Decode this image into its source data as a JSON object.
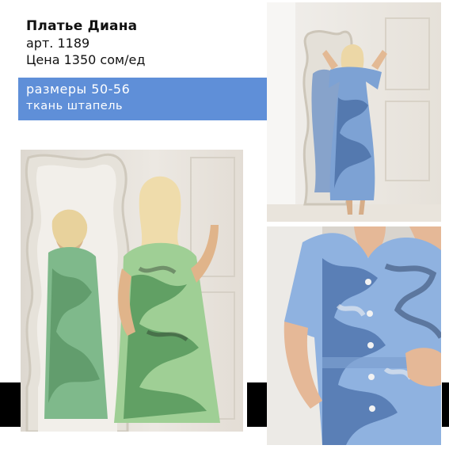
{
  "product": {
    "name": "Платье Диана",
    "article": "арт. 1189",
    "price": "Цена 1350 сом/ед"
  },
  "details": {
    "sizes": "размеры 50-56",
    "fabric": "ткань штапель"
  },
  "colors": {
    "accent": "#5f8fd8",
    "bar": "#000000",
    "wall": "#ece8e2"
  },
  "photos": [
    {
      "name": "green-dress-mirror-photo"
    },
    {
      "name": "blue-dress-full-length-photo"
    },
    {
      "name": "blue-dress-closeup-photo"
    }
  ]
}
